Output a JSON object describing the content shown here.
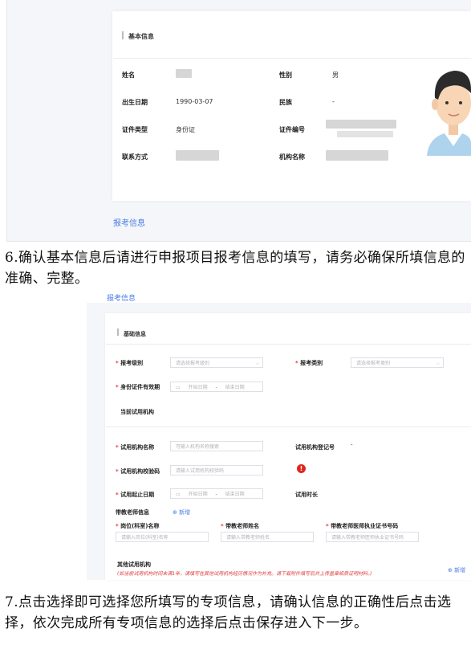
{
  "shot1": {
    "section_title": "基本信息",
    "fields": {
      "name_label": "姓名",
      "gender_label": "性别",
      "gender_value": "男",
      "birth_label": "出生日期",
      "birth_value": "1990-03-07",
      "ethnic_label": "民族",
      "ethnic_value": "-",
      "idtype_label": "证件类型",
      "idtype_value": "身份证",
      "idno_label": "证件编号",
      "contact_label": "联系方式",
      "org_label": "机构名称"
    },
    "footer_link": "报考信息"
  },
  "para6": "6.确认基本信息后请进行申报项目报考信息的填写，请务必确保所填信息的准确、完整。",
  "shot2": {
    "top_link": "报考信息",
    "section_title": "基础信息",
    "exam_level_label": "报考级别",
    "exam_level_placeholder": "请选择报考级别",
    "exam_type_label": "报考类别",
    "exam_type_placeholder": "请选择报考类别",
    "id_validity_label": "身份证件有效期",
    "start_date_placeholder": "开始日期",
    "date_sep": "-",
    "end_date_placeholder": "结束日期",
    "current_org_title": "当前试用机构",
    "org_name_label": "试用机构名称",
    "org_name_placeholder": "可输入机构名称搜索",
    "org_reg_label": "试用机构登记号",
    "org_reg_value": "-",
    "org_code_label": "试用机构校验码",
    "org_code_placeholder": "请输入试用机构校验码",
    "trial_date_label": "试用起止日期",
    "trial_duration_label": "试用时长",
    "teacher_info_title": "带教老师信息",
    "add_label": "新增",
    "post_label": "岗位(科室)名称",
    "post_placeholder": "请输入岗位(科室)名称",
    "teacher_name_label": "带教老师姓名",
    "teacher_name_placeholder": "请输入带教老师姓名",
    "teacher_cert_label": "带教老师医师执业证书号码",
    "teacher_cert_placeholder": "请输入带教老师医师执业证书号码",
    "other_org_title": "其他试用机构",
    "other_org_note": "(如当前试用机构时间未满1年，请填写在其他试用机构经历情况作为补充。请下载附件填写后并上传盖章纸质证明材料。)",
    "other_add_label": "新增"
  },
  "para7": "7.点击选择即可选择您所填写的专项信息，请确认信息的正确性后点击选择，依次完成所有专项信息的选择后点击保存进入下一步。"
}
